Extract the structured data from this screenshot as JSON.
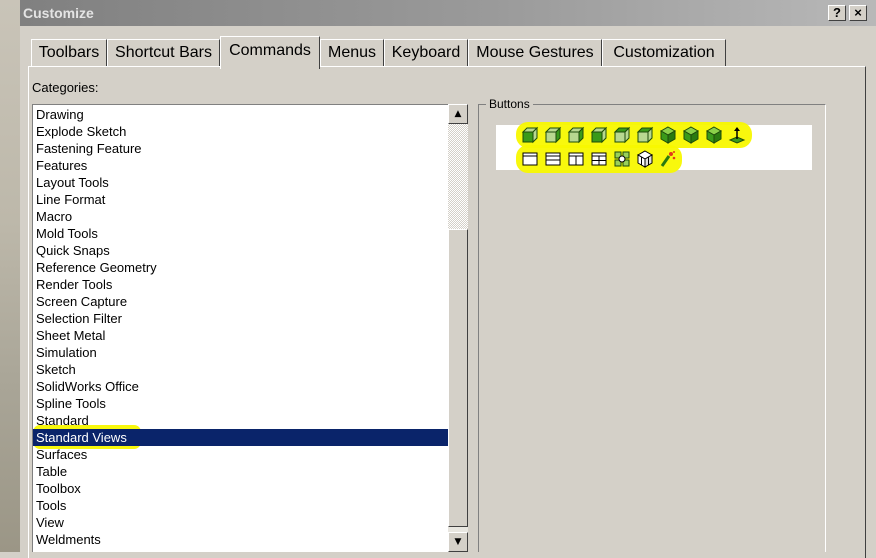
{
  "window": {
    "title": "Customize",
    "help_label": "?",
    "close_label": "×"
  },
  "tabs": [
    {
      "label": "Toolbars",
      "active": false
    },
    {
      "label": "Shortcut Bars",
      "active": false
    },
    {
      "label": "Commands",
      "active": true
    },
    {
      "label": "Menus",
      "active": false
    },
    {
      "label": "Keyboard",
      "active": false
    },
    {
      "label": "Mouse Gestures",
      "active": false
    },
    {
      "label": "Customization",
      "active": false
    }
  ],
  "categories": {
    "label": "Categories:",
    "selected": "Standard Views",
    "items": [
      "Drawing",
      "Explode Sketch",
      "Fastening Feature",
      "Features",
      "Layout Tools",
      "Line Format",
      "Macro",
      "Mold Tools",
      "Quick Snaps",
      "Reference Geometry",
      "Render Tools",
      "Screen Capture",
      "Selection Filter",
      "Sheet Metal",
      "Simulation",
      "Sketch",
      "SolidWorks Office",
      "Spline Tools",
      "Standard",
      "Standard Views",
      "Surfaces",
      "Table",
      "Toolbox",
      "Tools",
      "View",
      "Weldments"
    ]
  },
  "buttons": {
    "label": "Buttons",
    "row1": [
      "front-view-icon",
      "back-view-icon",
      "left-view-icon",
      "right-view-icon",
      "top-view-icon",
      "bottom-view-icon",
      "isometric-view-icon",
      "trimetric-view-icon",
      "dimetric-view-icon",
      "normal-to-icon"
    ],
    "row2": [
      "single-view-icon",
      "two-view-horizontal-icon",
      "two-view-vertical-icon",
      "four-view-icon",
      "link-views-icon",
      "view-selector-icon",
      "view-orientation-wand-icon"
    ]
  },
  "colors": {
    "highlight": "#f8f800",
    "selection": "#0a246a",
    "icon_green": "#3a9a1a"
  }
}
